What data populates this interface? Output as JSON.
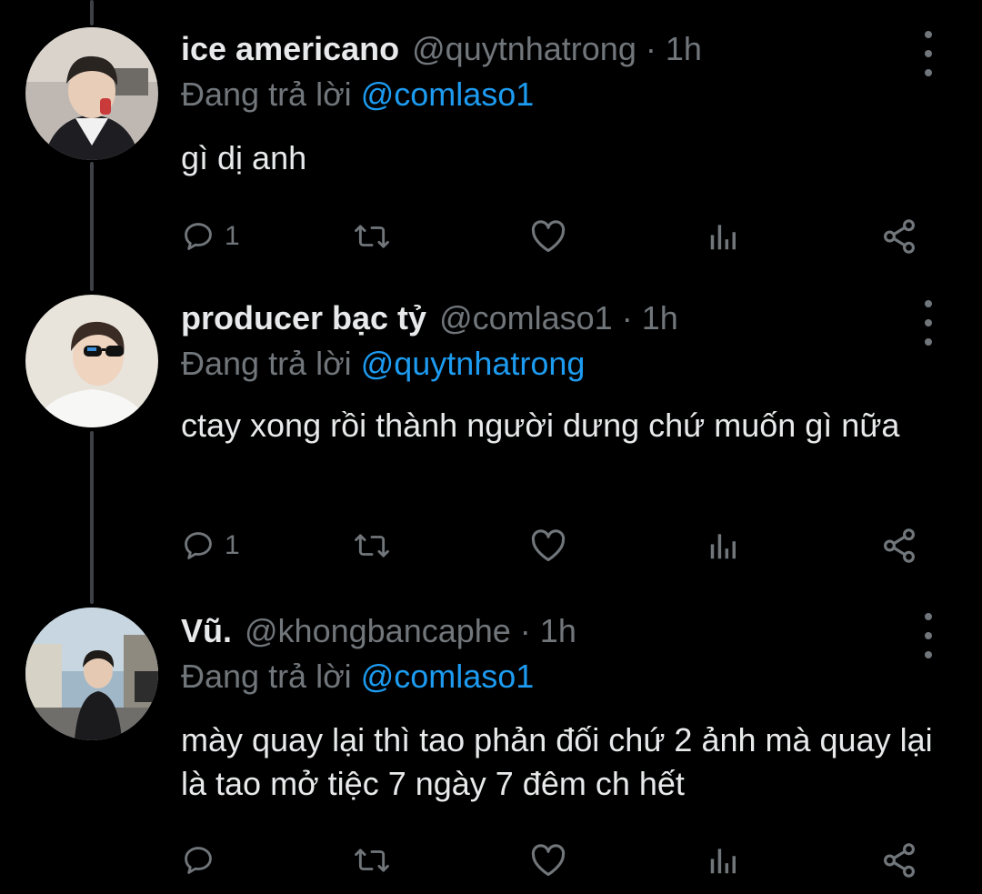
{
  "colors": {
    "background": "#000000",
    "muted": "#71767b",
    "link": "#1d9bf0",
    "text": "#e7e9ea"
  },
  "tweets": [
    {
      "name": "ice americano",
      "handle": "@quytnhatrong",
      "separator": "·",
      "time": "1h",
      "replying_prefix": "Đang trả lời",
      "replying_to": "@comlaso1",
      "text": "gì dị anh",
      "reply_count": "1",
      "icons": [
        "reply-icon",
        "retweet-icon",
        "like-icon",
        "analytics-icon",
        "share-icon",
        "more-icon"
      ]
    },
    {
      "name": "producer bạc tỷ",
      "handle": "@comlaso1",
      "separator": "·",
      "time": "1h",
      "replying_prefix": "Đang trả lời",
      "replying_to": "@quytnhatrong",
      "text": "ctay xong rồi thành người dưng chứ muốn gì nữa",
      "reply_count": "1",
      "icons": [
        "reply-icon",
        "retweet-icon",
        "like-icon",
        "analytics-icon",
        "share-icon",
        "more-icon"
      ]
    },
    {
      "name": "Vũ.",
      "handle": "@khongbancaphe",
      "separator": "·",
      "time": "1h",
      "replying_prefix": "Đang trả lời",
      "replying_to": "@comlaso1",
      "text": "mày quay lại thì tao phản đối chứ 2 ảnh mà quay lại là tao mở tiệc 7 ngày 7 đêm ch hết",
      "reply_count": "",
      "icons": [
        "reply-icon",
        "retweet-icon",
        "like-icon",
        "analytics-icon",
        "share-icon",
        "more-icon"
      ]
    }
  ]
}
